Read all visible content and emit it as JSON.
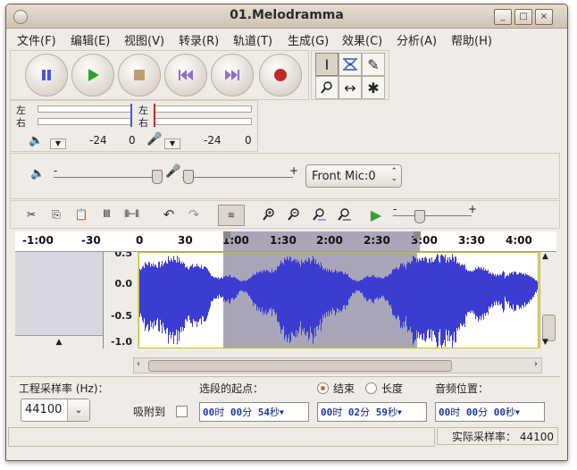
{
  "window": {
    "title": "01.Melodramma"
  },
  "window_controls": {
    "minimize": "_",
    "maximize": "□",
    "close": "×"
  },
  "menu": [
    {
      "label": "文件(F)"
    },
    {
      "label": "编辑(E)"
    },
    {
      "label": "视图(V)"
    },
    {
      "label": "转录(R)"
    },
    {
      "label": "轨道(T)"
    },
    {
      "label": "生成(G)"
    },
    {
      "label": "效果(C)"
    },
    {
      "label": "分析(A)"
    },
    {
      "label": "帮助(H)"
    }
  ],
  "meters": {
    "left": "左",
    "right": "右",
    "play_minus": "-24",
    "play_zero": "0",
    "rec_minus": "-24",
    "rec_zero": "0"
  },
  "mixer": {
    "minus": "-",
    "plus": "+",
    "input_source": "Front Mic:0"
  },
  "speed": {
    "minus": "-",
    "plus": "+"
  },
  "ruler": {
    "labels": [
      "-1:00",
      "-30",
      "0",
      "30",
      "1:00",
      "1:30",
      "2:00",
      "2:30",
      "3:00",
      "3:30",
      "4:00"
    ]
  },
  "track": {
    "scale_labels": [
      "0.5",
      "0.0",
      "-0.5",
      "-1.0"
    ]
  },
  "bottom": {
    "rate_label": "工程采样率 (Hz)：",
    "rate_value": "44100",
    "snap_label": "吸附到",
    "sel_start_label": "选段的起点：",
    "end_label": "结束",
    "length_label": "长度",
    "audio_pos_label": "音频位置：",
    "sel_start": {
      "h": "00",
      "hu": "时",
      "m": "00",
      "mu": "分",
      "s": "54",
      "su": "秒"
    },
    "sel_end": {
      "h": "00",
      "hu": "时",
      "m": "02",
      "mu": "分",
      "s": "59",
      "su": "秒"
    },
    "audio_pos": {
      "h": "00",
      "hu": "时",
      "m": "00",
      "mu": "分",
      "s": "00",
      "su": "秒"
    }
  },
  "status": {
    "actual_rate": "实际采样率： 44100"
  },
  "colors": {
    "waveform": "#3c3cd2",
    "waveform_bg": "#ffffff",
    "selection": "#a8a6b8",
    "record": "#c22a2a",
    "play": "#2fa32f"
  }
}
